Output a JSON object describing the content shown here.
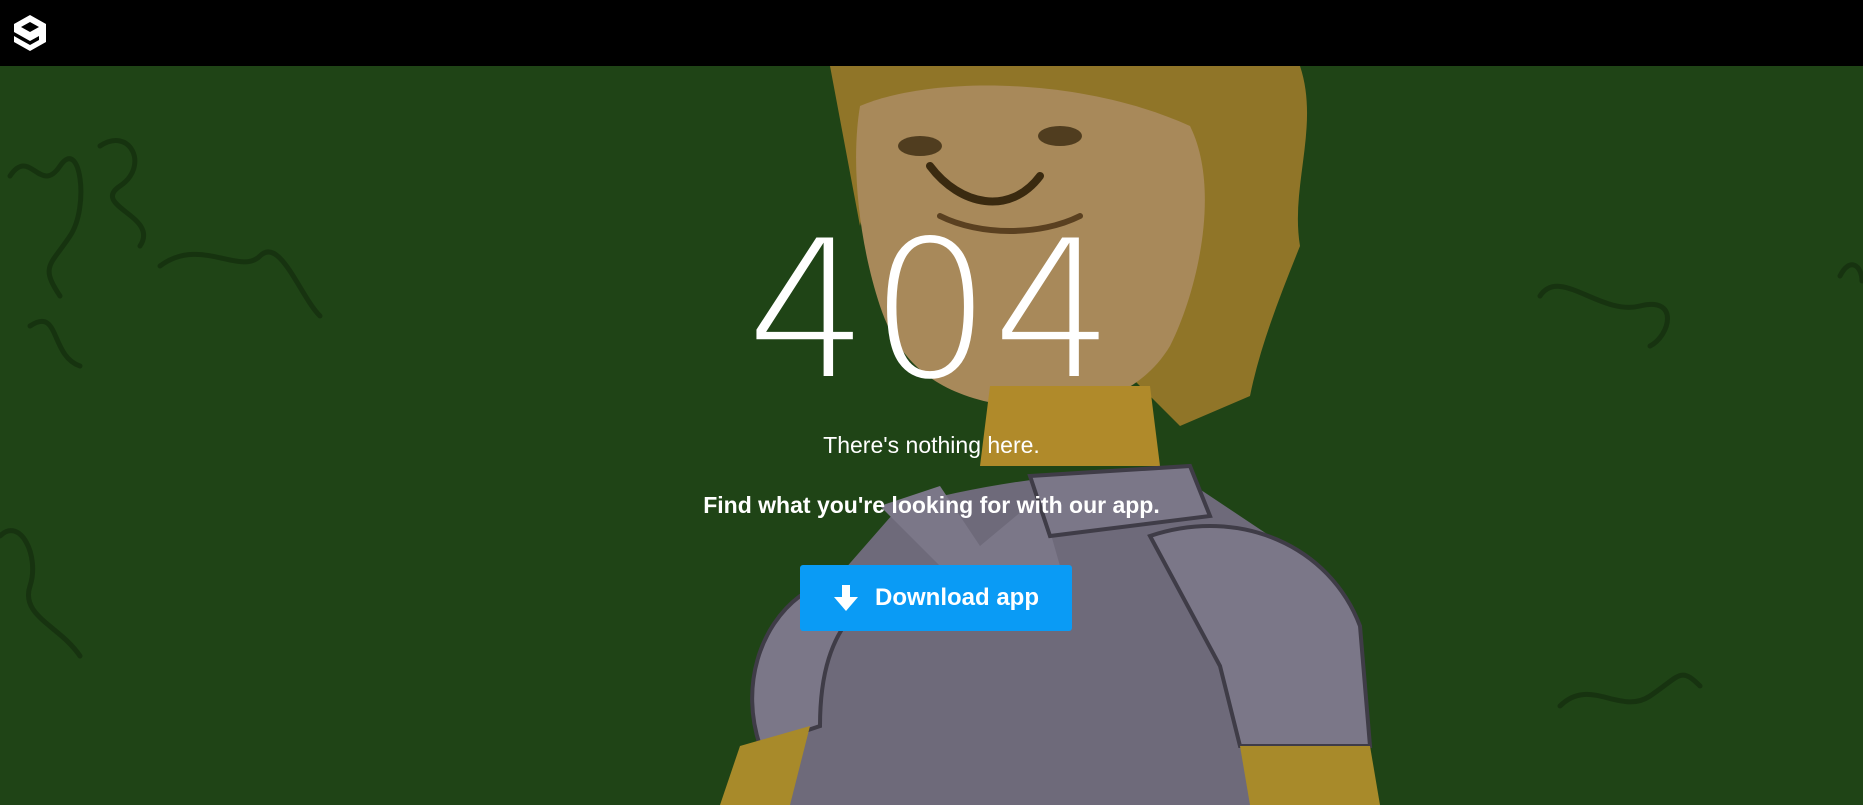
{
  "header": {
    "logo_icon": "9gag-logo-icon"
  },
  "error": {
    "code": "404",
    "message": "There's nothing here.",
    "cta_text": "Find what you're looking for with our app."
  },
  "download_button": {
    "label": "Download app",
    "icon": "download-arrow-icon",
    "color": "#0a9bf5"
  },
  "colors": {
    "topbar": "#000000",
    "background": "#1f4416"
  }
}
